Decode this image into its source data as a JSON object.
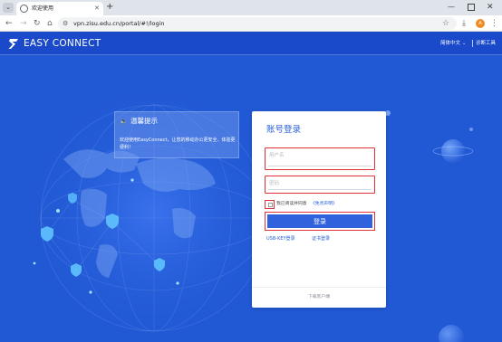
{
  "browser": {
    "tab_title": "欢迎使用",
    "new_tab_glyph": "+",
    "url": "vpn.zisu.edu.cn/portal/#!/login",
    "avatar_letter": "A",
    "icons": [
      "tab-menu-icon",
      "globe-icon",
      "close-icon",
      "new-tab-icon",
      "minimize-icon",
      "maximize-icon",
      "window-close-icon",
      "back-icon",
      "forward-icon",
      "reload-icon",
      "home-icon",
      "site-info-icon",
      "star-icon",
      "download-icon",
      "kebab-menu-icon"
    ]
  },
  "header": {
    "logo_text": "EASY CONNECT",
    "language": "简体中文",
    "tools": "诊断工具"
  },
  "notice": {
    "title": "温馨提示",
    "body": "欢迎使用EasyConnect，让您的移动办公更安全、体验更便利！"
  },
  "login": {
    "title": "账号登录",
    "username_placeholder": "用户名",
    "password_placeholder": "密码",
    "agree_text": "我已阅读并同意",
    "agree_link": "《免责声明》",
    "submit_label": "登录",
    "alt_usbkey": "USB-KEY登录",
    "alt_cert": "证书登录",
    "download_client": "下载客户端"
  },
  "colors": {
    "page_bg": "#2158d4",
    "header_bg": "#1a49c9",
    "accent": "#2f62dc",
    "highlight": "#e0303a"
  }
}
